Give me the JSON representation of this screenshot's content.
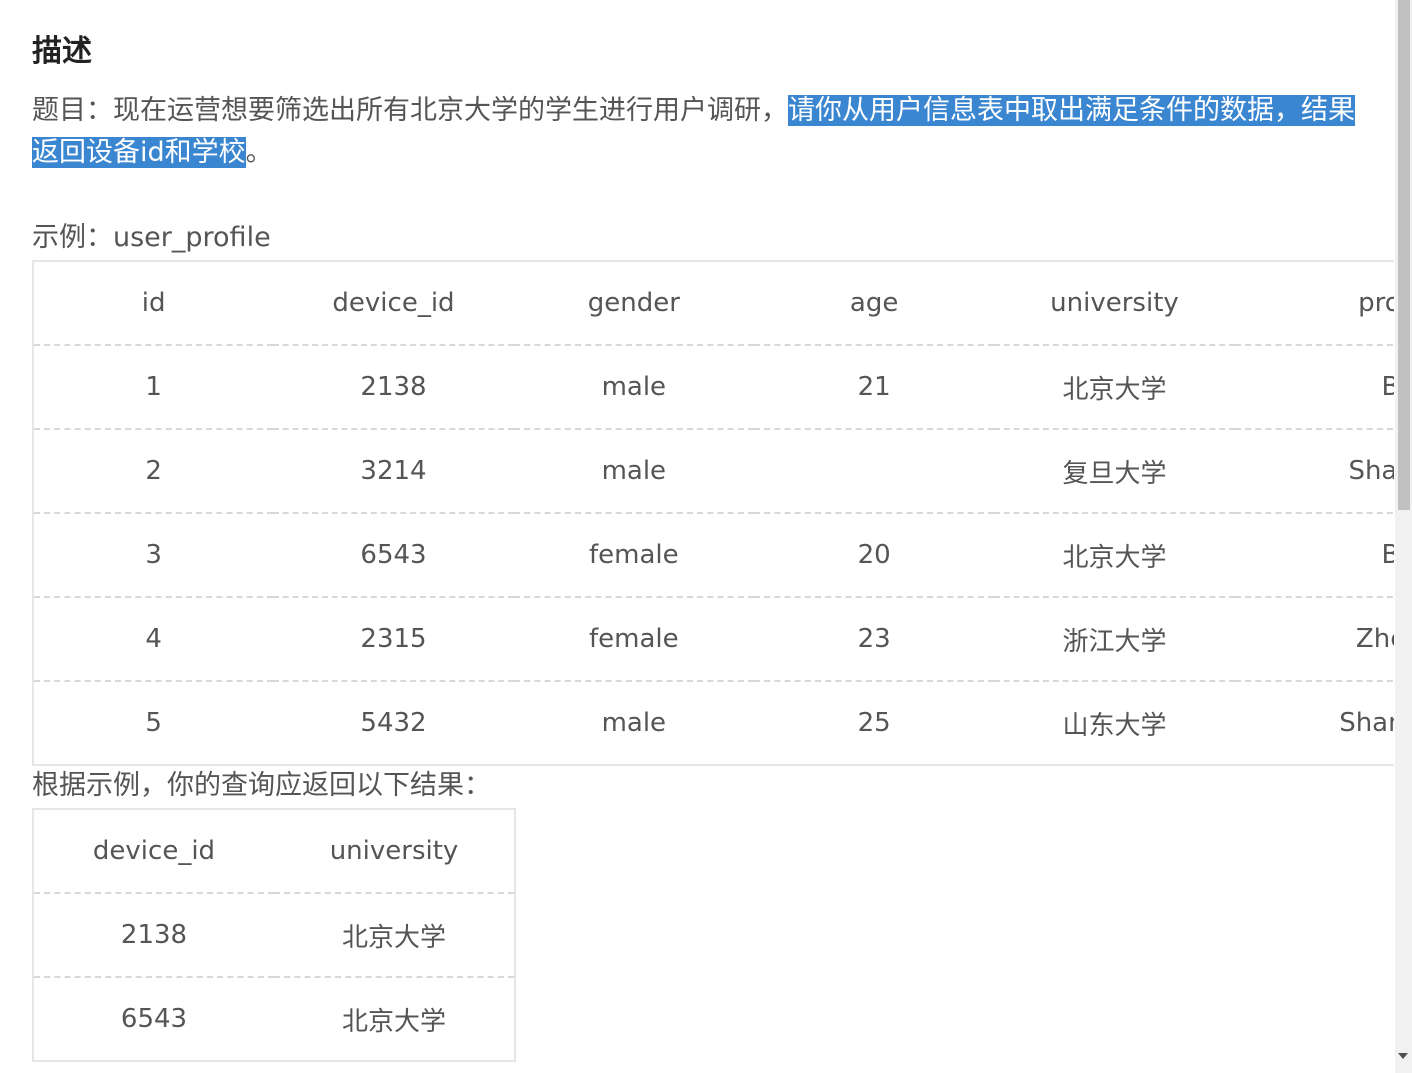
{
  "heading": "描述",
  "description": {
    "plain": "题目：现在运营想要筛选出所有北京大学的学生进行用户调研，",
    "highlighted": "请你从用户信息表中取出满足条件的数据，结果返回设备id和学校",
    "tail": "。"
  },
  "example_label": "示例：user_profile",
  "profile_table": {
    "headers": [
      "id",
      "device_id",
      "gender",
      "age",
      "university",
      "province"
    ],
    "rows": [
      [
        "1",
        "2138",
        "male",
        "21",
        "北京大学",
        "Beijing"
      ],
      [
        "2",
        "3214",
        "male",
        "",
        "复旦大学",
        "Shanghai"
      ],
      [
        "3",
        "6543",
        "female",
        "20",
        "北京大学",
        "Beijing"
      ],
      [
        "4",
        "2315",
        "female",
        "23",
        "浙江大学",
        "ZheJiang"
      ],
      [
        "5",
        "5432",
        "male",
        "25",
        "山东大学",
        "Shandong"
      ]
    ]
  },
  "result_label": "根据示例，你的查询应返回以下结果：",
  "result_table": {
    "headers": [
      "device_id",
      "university"
    ],
    "rows": [
      [
        "2138",
        "北京大学"
      ],
      [
        "6543",
        "北京大学"
      ]
    ]
  },
  "colors": {
    "highlight": "#3b86d1",
    "text": "#555555",
    "heading": "#222222"
  }
}
